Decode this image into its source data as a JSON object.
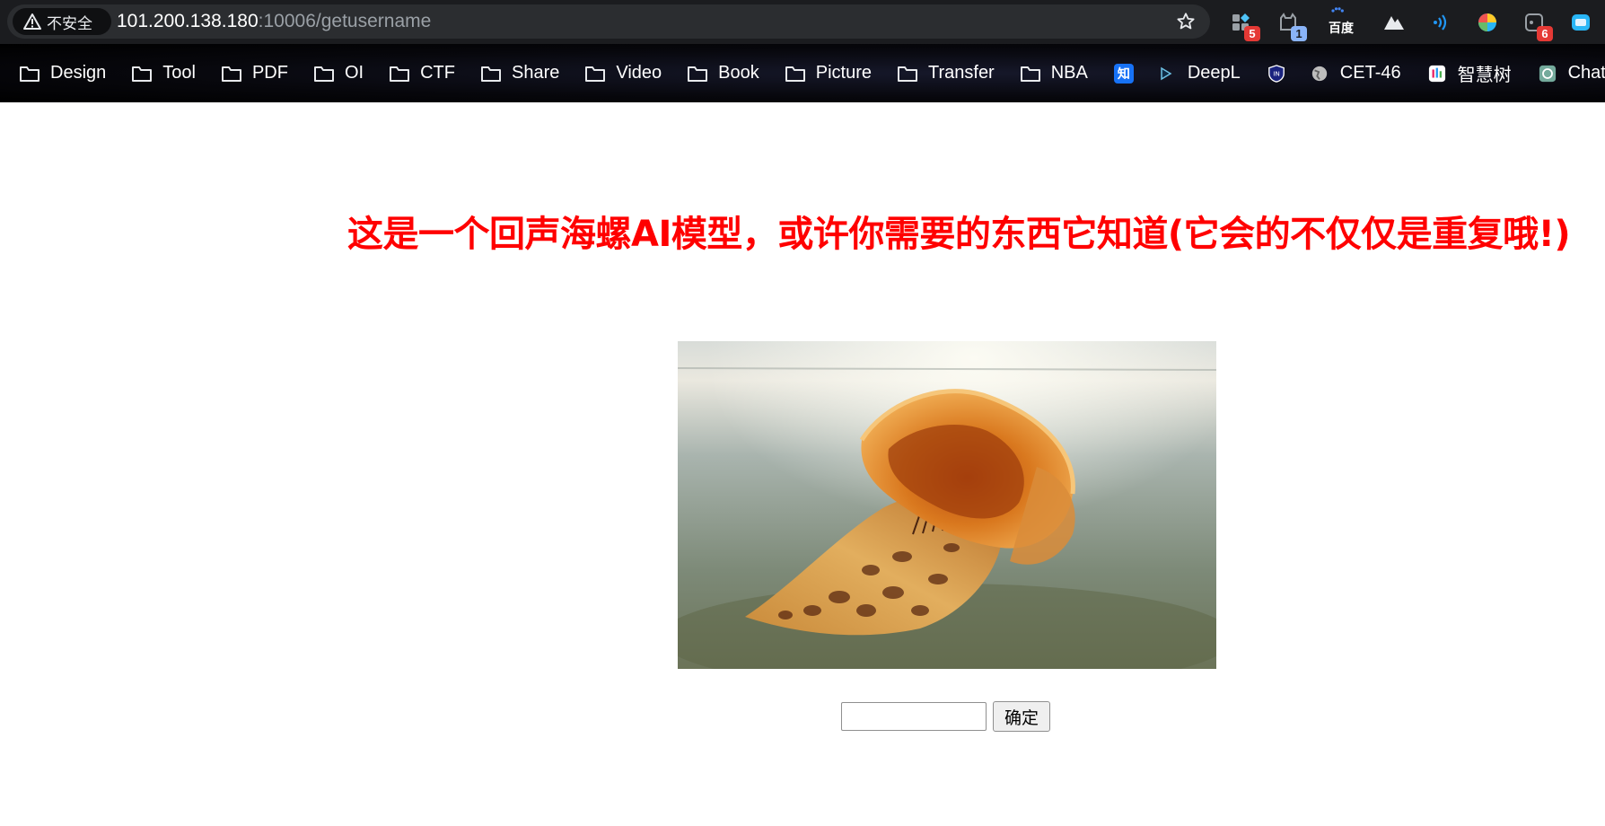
{
  "browser": {
    "security_label": "不安全",
    "url_host": "101.200.138.180",
    "url_path": ":10006/getusername",
    "extensions": [
      {
        "icon": "extension-grid-icon",
        "badge": "5"
      },
      {
        "icon": "cat-extension-icon",
        "badge": "1"
      },
      {
        "icon": "baidu-icon",
        "label": "百度"
      },
      {
        "icon": "mountain-icon"
      },
      {
        "icon": "wifi-signal-icon"
      },
      {
        "icon": "colorful-ball-icon"
      },
      {
        "icon": "square-extension-icon",
        "badge": "6"
      },
      {
        "icon": "partial-extension-icon"
      }
    ]
  },
  "bookmarks": [
    {
      "label": "Design",
      "icon": "folder-icon"
    },
    {
      "label": "Tool",
      "icon": "folder-icon"
    },
    {
      "label": "PDF",
      "icon": "folder-icon"
    },
    {
      "label": "OI",
      "icon": "folder-icon"
    },
    {
      "label": "CTF",
      "icon": "folder-icon"
    },
    {
      "label": "Share",
      "icon": "folder-icon"
    },
    {
      "label": "Video",
      "icon": "folder-icon"
    },
    {
      "label": "Book",
      "icon": "folder-icon"
    },
    {
      "label": "Picture",
      "icon": "folder-icon"
    },
    {
      "label": "Transfer",
      "icon": "folder-icon"
    },
    {
      "label": "NBA",
      "icon": "folder-icon"
    },
    {
      "label": "",
      "icon": "zhihu-icon",
      "glyph": "知"
    },
    {
      "label": "DeepL",
      "icon": "deepl-icon"
    },
    {
      "label": "",
      "icon": "shield-icon"
    },
    {
      "label": "CET-46",
      "icon": "globe-icon"
    },
    {
      "label": "智慧树",
      "icon": "zhihuishu-icon"
    },
    {
      "label": "ChatGPT",
      "icon": "openai-icon"
    }
  ],
  "page": {
    "headline": "这是一个回声海螺AI模型，或许你需要的东西它知道(它会的不仅仅是重复哦!)",
    "input_value": "",
    "submit_label": "确定"
  },
  "colors": {
    "headline": "#ff0000",
    "topbar": "#1b1c1f",
    "omnibox": "#2b2d30"
  }
}
